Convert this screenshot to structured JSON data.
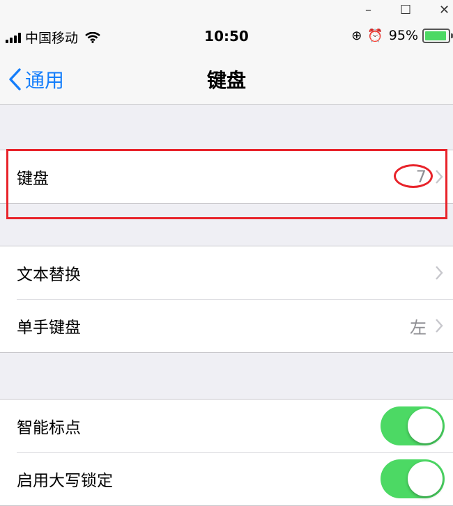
{
  "window_controls": {
    "minimize": "–",
    "maximize": "☐",
    "close": "✕"
  },
  "status_bar": {
    "carrier": "中国移动",
    "time": "10:50",
    "battery_percent": "95%",
    "battery_level": 0.95,
    "icons": [
      "signal-icon",
      "wifi-icon",
      "rotation-lock-icon",
      "alarm-icon",
      "battery-icon"
    ]
  },
  "nav": {
    "back_label": "通用",
    "title": "键盘"
  },
  "group1": {
    "items": [
      {
        "label": "键盘",
        "detail": "7"
      }
    ]
  },
  "group2": {
    "items": [
      {
        "label": "文本替换"
      },
      {
        "label": "单手键盘",
        "detail": "左"
      }
    ]
  },
  "group3": {
    "items": [
      {
        "label": "智能标点",
        "toggle": true
      },
      {
        "label": "启用大写锁定",
        "toggle": true
      }
    ]
  },
  "colors": {
    "accent": "#157efb",
    "toggle_on": "#4cd964",
    "annotation": "#e8232a"
  }
}
